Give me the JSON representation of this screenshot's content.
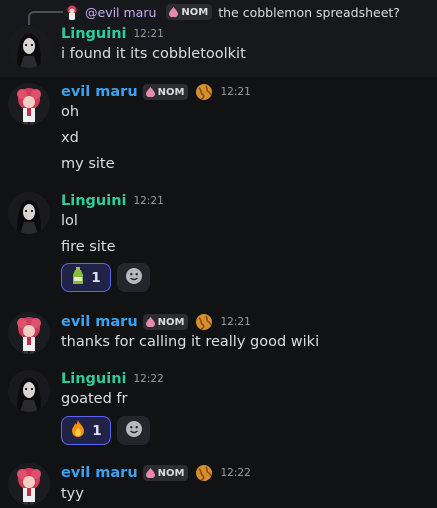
{
  "reply": {
    "author": "@evil maru",
    "tag": "NOM",
    "text": "the cobblemon spreadsheet?"
  },
  "messages": [
    {
      "author": "Linguini",
      "time": "12:21",
      "lines": [
        "i found it its cobbletoolkit"
      ]
    },
    {
      "author": "evil maru",
      "tag": "NOM",
      "time": "12:21",
      "lines": [
        "oh",
        "xd",
        "my site"
      ]
    },
    {
      "author": "Linguini",
      "time": "12:21",
      "lines": [
        "lol",
        "fire site"
      ],
      "reaction": {
        "emoji": "bottle-emoji",
        "count": "1"
      }
    },
    {
      "author": "evil maru",
      "tag": "NOM",
      "time": "12:21",
      "lines": [
        "thanks for calling it really good wiki"
      ]
    },
    {
      "author": "Linguini",
      "time": "12:22",
      "lines": [
        "goated fr"
      ],
      "reaction": {
        "emoji": "fire-emoji",
        "count": "1"
      }
    },
    {
      "author": "evil maru",
      "tag": "NOM",
      "time": "12:22",
      "lines": [
        "tyy"
      ]
    }
  ],
  "colors": {
    "background": "#111214",
    "linguini": "#2ecc9a",
    "evil_maru": "#3aa2f0",
    "reaction_border": "#5865f2"
  }
}
